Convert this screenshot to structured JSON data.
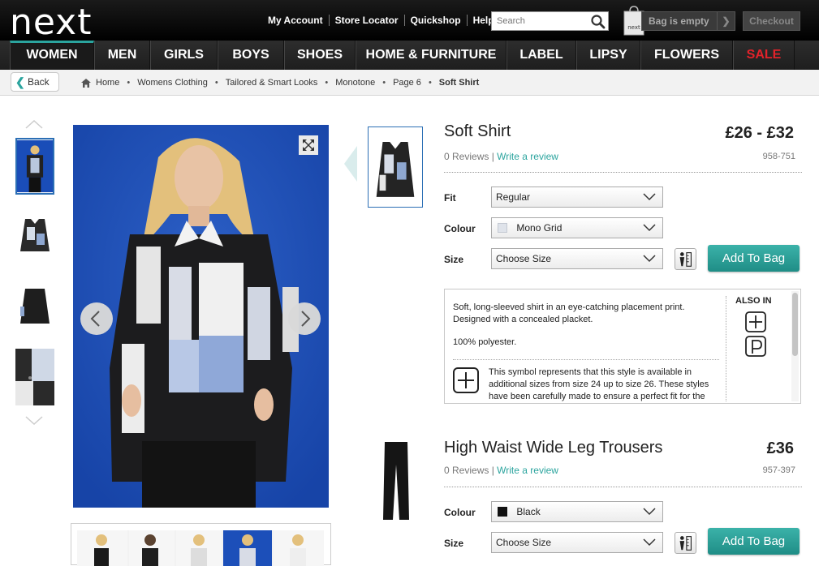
{
  "header": {
    "logo": "next",
    "links": [
      "My Account",
      "Store Locator",
      "Quickshop",
      "Help"
    ],
    "search_placeholder": "Search",
    "bag_label": "Bag is empty",
    "checkout_label": "Checkout"
  },
  "nav": {
    "items": [
      {
        "label": "WOMEN",
        "active": true
      },
      {
        "label": "MEN"
      },
      {
        "label": "GIRLS"
      },
      {
        "label": "BOYS"
      },
      {
        "label": "SHOES"
      },
      {
        "label": "HOME & FURNITURE"
      },
      {
        "label": "LABEL"
      },
      {
        "label": "LIPSY"
      },
      {
        "label": "FLOWERS"
      },
      {
        "label": "SALE",
        "color": "#e3222a"
      }
    ]
  },
  "breadcrumb": {
    "back_label": "Back",
    "items": [
      "Home",
      "Womens Clothing",
      "Tailored & Smart Looks",
      "Monotone",
      "Page 6",
      "Soft Shirt"
    ]
  },
  "product1": {
    "title": "Soft Shirt",
    "price": "£26 - £32",
    "reviews": "0 Reviews",
    "write_review": "Write a review",
    "code": "958-751",
    "fit_label": "Fit",
    "fit_value": "Regular",
    "colour_label": "Colour",
    "colour_value": "Mono Grid",
    "size_label": "Size",
    "size_value": "Choose Size",
    "add_label": "Add To Bag",
    "description": "Soft, long-sleeved shirt in an eye-catching placement print. Designed with a concealed placket.",
    "material": "100% polyester.",
    "plus_note": "This symbol represents that this style is available in additional sizes from size 24 up to size 26. These styles have been carefully made to ensure a perfect fit for the",
    "also_in_label": "ALSO IN"
  },
  "product2": {
    "title": "High Waist Wide Leg Trousers",
    "price": "£36",
    "reviews": "0 Reviews",
    "write_review": "Write a review",
    "code": "957-397",
    "colour_label": "Colour",
    "colour_value": "Black",
    "size_label": "Size",
    "size_value": "Choose Size",
    "add_label": "Add To Bag"
  },
  "colors": {
    "accent": "#2ba49e",
    "sale": "#e3222a",
    "image_bg": "#1a4db8"
  }
}
